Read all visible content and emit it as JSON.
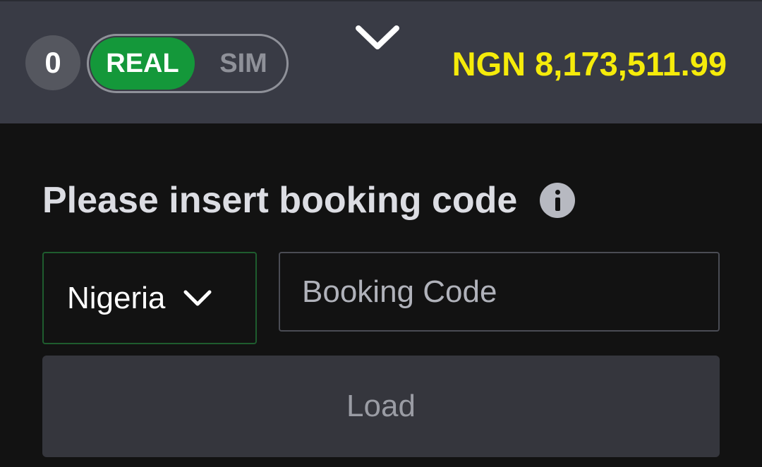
{
  "header": {
    "bet_count": "0",
    "mode_real": "REAL",
    "mode_sim": "SIM",
    "active_mode": "REAL",
    "balance": "NGN 8,173,511.99",
    "colors": {
      "background": "#393b45",
      "real_active": "#14983a",
      "balance_text": "#f5eb0a"
    },
    "collapse_icon": "chevron-down-icon"
  },
  "booking": {
    "title": "Please insert booking code",
    "info_icon": "info-icon",
    "country": "Nigeria",
    "country_icon": "chevron-down-icon",
    "code_placeholder": "Booking Code",
    "code_value": "",
    "load_label": "Load"
  }
}
